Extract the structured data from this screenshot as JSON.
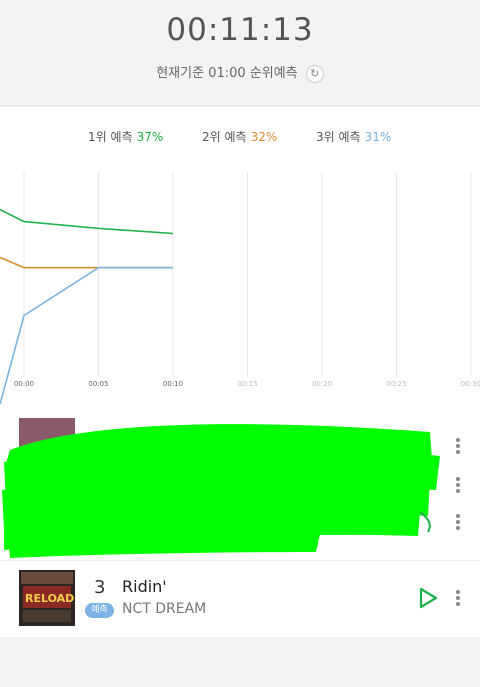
{
  "header": {
    "time": "00:11:13",
    "basis": "현재기준 01:00 순위예측",
    "refresh_icon": "refresh-icon"
  },
  "chart_data": {
    "type": "line",
    "x": [
      "00:00",
      "00:05",
      "00:10"
    ],
    "x_ticks": [
      "00:00",
      "00:05",
      "00:10",
      "00:15",
      "00:20",
      "00:25",
      "00:30"
    ],
    "series": [
      {
        "name": "1위 예측",
        "pct": "37%",
        "color": "#1db34a",
        "values": [
          49,
          45.5,
          43.5,
          42
        ]
      },
      {
        "name": "2위 예측",
        "pct": "32%",
        "color": "#d58f2a",
        "values": [
          35,
          32,
          32,
          32
        ]
      },
      {
        "name": "3위 예측",
        "pct": "31%",
        "color": "#7ab3de",
        "values": [
          -8,
          18,
          32,
          32
        ]
      }
    ],
    "grid": true
  },
  "songs": [
    {
      "rank": "3",
      "badge": "예측",
      "title": "Ridin'",
      "artist": "NCT DREAM",
      "album_text": "RELOAD"
    }
  ],
  "colors": {
    "play": "#1db34a",
    "badge": "#7bb3e6"
  }
}
